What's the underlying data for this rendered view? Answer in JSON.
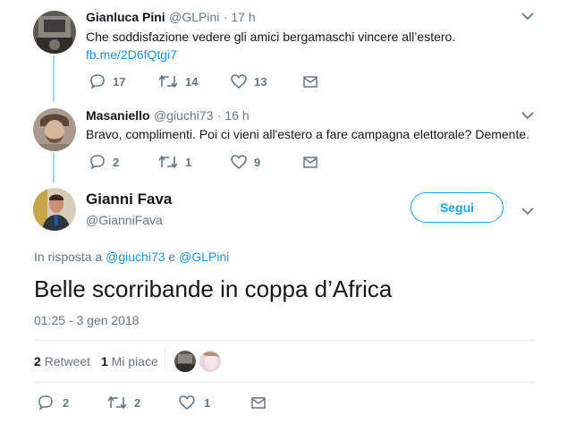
{
  "tweet1": {
    "name": "Gianluca Pini",
    "handle": "@GLPini",
    "time": "· 17 h",
    "text": "Che soddisfazione vedere gli amici bergamaschi vincere all’estero.",
    "link": "fb.me/2D6fQtgi7",
    "replies": "17",
    "retweets": "14",
    "likes": "13"
  },
  "tweet2": {
    "name": "Masaniello",
    "handle": "@giuchi73",
    "time": "· 16 h",
    "text": "Bravo, complimenti. Poi ci vieni all'estero a fare campagna elettorale? Demente.",
    "replies": "2",
    "retweets": "1",
    "likes": "9"
  },
  "main": {
    "name": "Gianni Fava",
    "handle": "@GianniFava",
    "follow_label": "Segui",
    "reply_prefix": "In risposta a",
    "reply_to_1": "@giuchi73",
    "reply_and": "e",
    "reply_to_2": "@GLPini",
    "text": "Belle scorribande in coppa d’Africa",
    "timestamp": "01:25 - 3 gen 2018",
    "retweet_count": "2",
    "retweet_label": "Retweet",
    "like_count": "1",
    "like_label": "Mi piace",
    "replies": "2",
    "retweets": "2",
    "likes": "1"
  },
  "colors": {
    "accent": "#1da1f2",
    "link": "#1b95e0",
    "muted": "#657786",
    "thread": "#a6d6f3"
  },
  "icons": [
    "reply-icon",
    "retweet-icon",
    "heart-icon",
    "mail-icon",
    "chevron-down-icon"
  ]
}
